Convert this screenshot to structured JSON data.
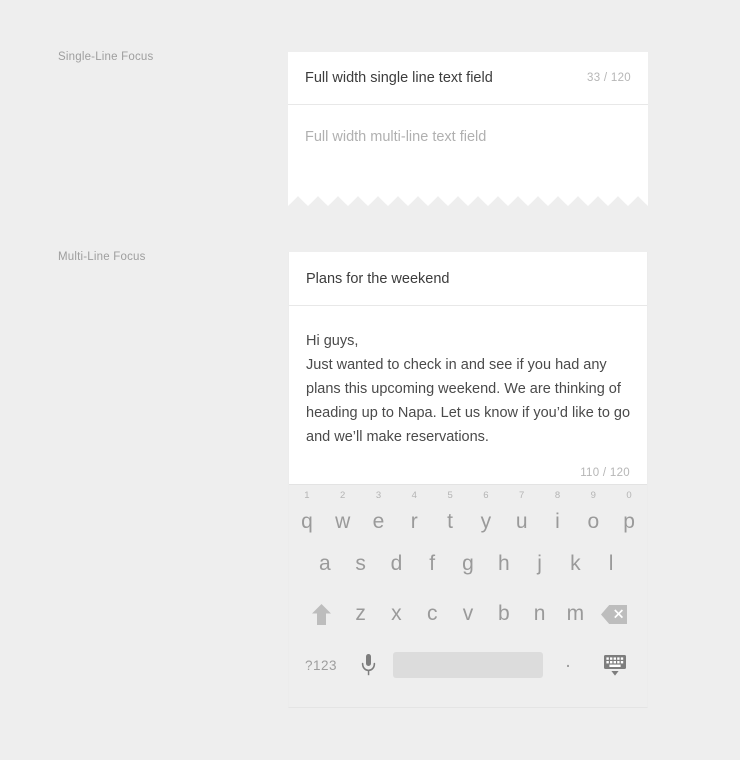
{
  "theme": {
    "page_bg": "#eeeeee",
    "card_bg": "#ffffff",
    "label_color": "#9e9e9e",
    "text_color": "#3c3c3c",
    "placeholder_color": "#b0b0b0",
    "counter_color": "#b6b6b6",
    "keyboard_bg": "#eeeeee",
    "key_color": "#9a9a9a",
    "spacebar_color": "#dcdcdc"
  },
  "sections": {
    "single": {
      "label": "Single-Line Focus",
      "single_line_value": "Full width single line text field",
      "single_line_counter": "33 / 120",
      "multi_line_placeholder": "Full width multi-line text field"
    },
    "multi": {
      "label": "Multi-Line Focus",
      "subject_value": "Plans for the weekend",
      "body_lines": [
        "Hi guys,",
        "Just wanted to check in and see if you had any",
        "plans this upcoming weekend. We are thinking of",
        "heading up to Napa. Let us know if you’d like to go",
        "and we’ll make reservations."
      ],
      "body_counter": "110 / 120"
    }
  },
  "keyboard": {
    "row1": [
      {
        "char": "q",
        "num": "1"
      },
      {
        "char": "w",
        "num": "2"
      },
      {
        "char": "e",
        "num": "3"
      },
      {
        "char": "r",
        "num": "4"
      },
      {
        "char": "t",
        "num": "5"
      },
      {
        "char": "y",
        "num": "6"
      },
      {
        "char": "u",
        "num": "7"
      },
      {
        "char": "i",
        "num": "8"
      },
      {
        "char": "o",
        "num": "9"
      },
      {
        "char": "p",
        "num": "0"
      }
    ],
    "row2": [
      "a",
      "s",
      "d",
      "f",
      "g",
      "h",
      "j",
      "k",
      "l"
    ],
    "row3": [
      "z",
      "x",
      "c",
      "v",
      "b",
      "n",
      "m"
    ],
    "shift_icon": "shift-arrow-icon",
    "backspace_icon": "backspace-icon",
    "row4": {
      "symbols_label": "?123",
      "mic_icon": "microphone-icon",
      "spacebar_label": "",
      "period_label": ".",
      "hide_keyboard_icon": "hide-keyboard-icon"
    }
  }
}
